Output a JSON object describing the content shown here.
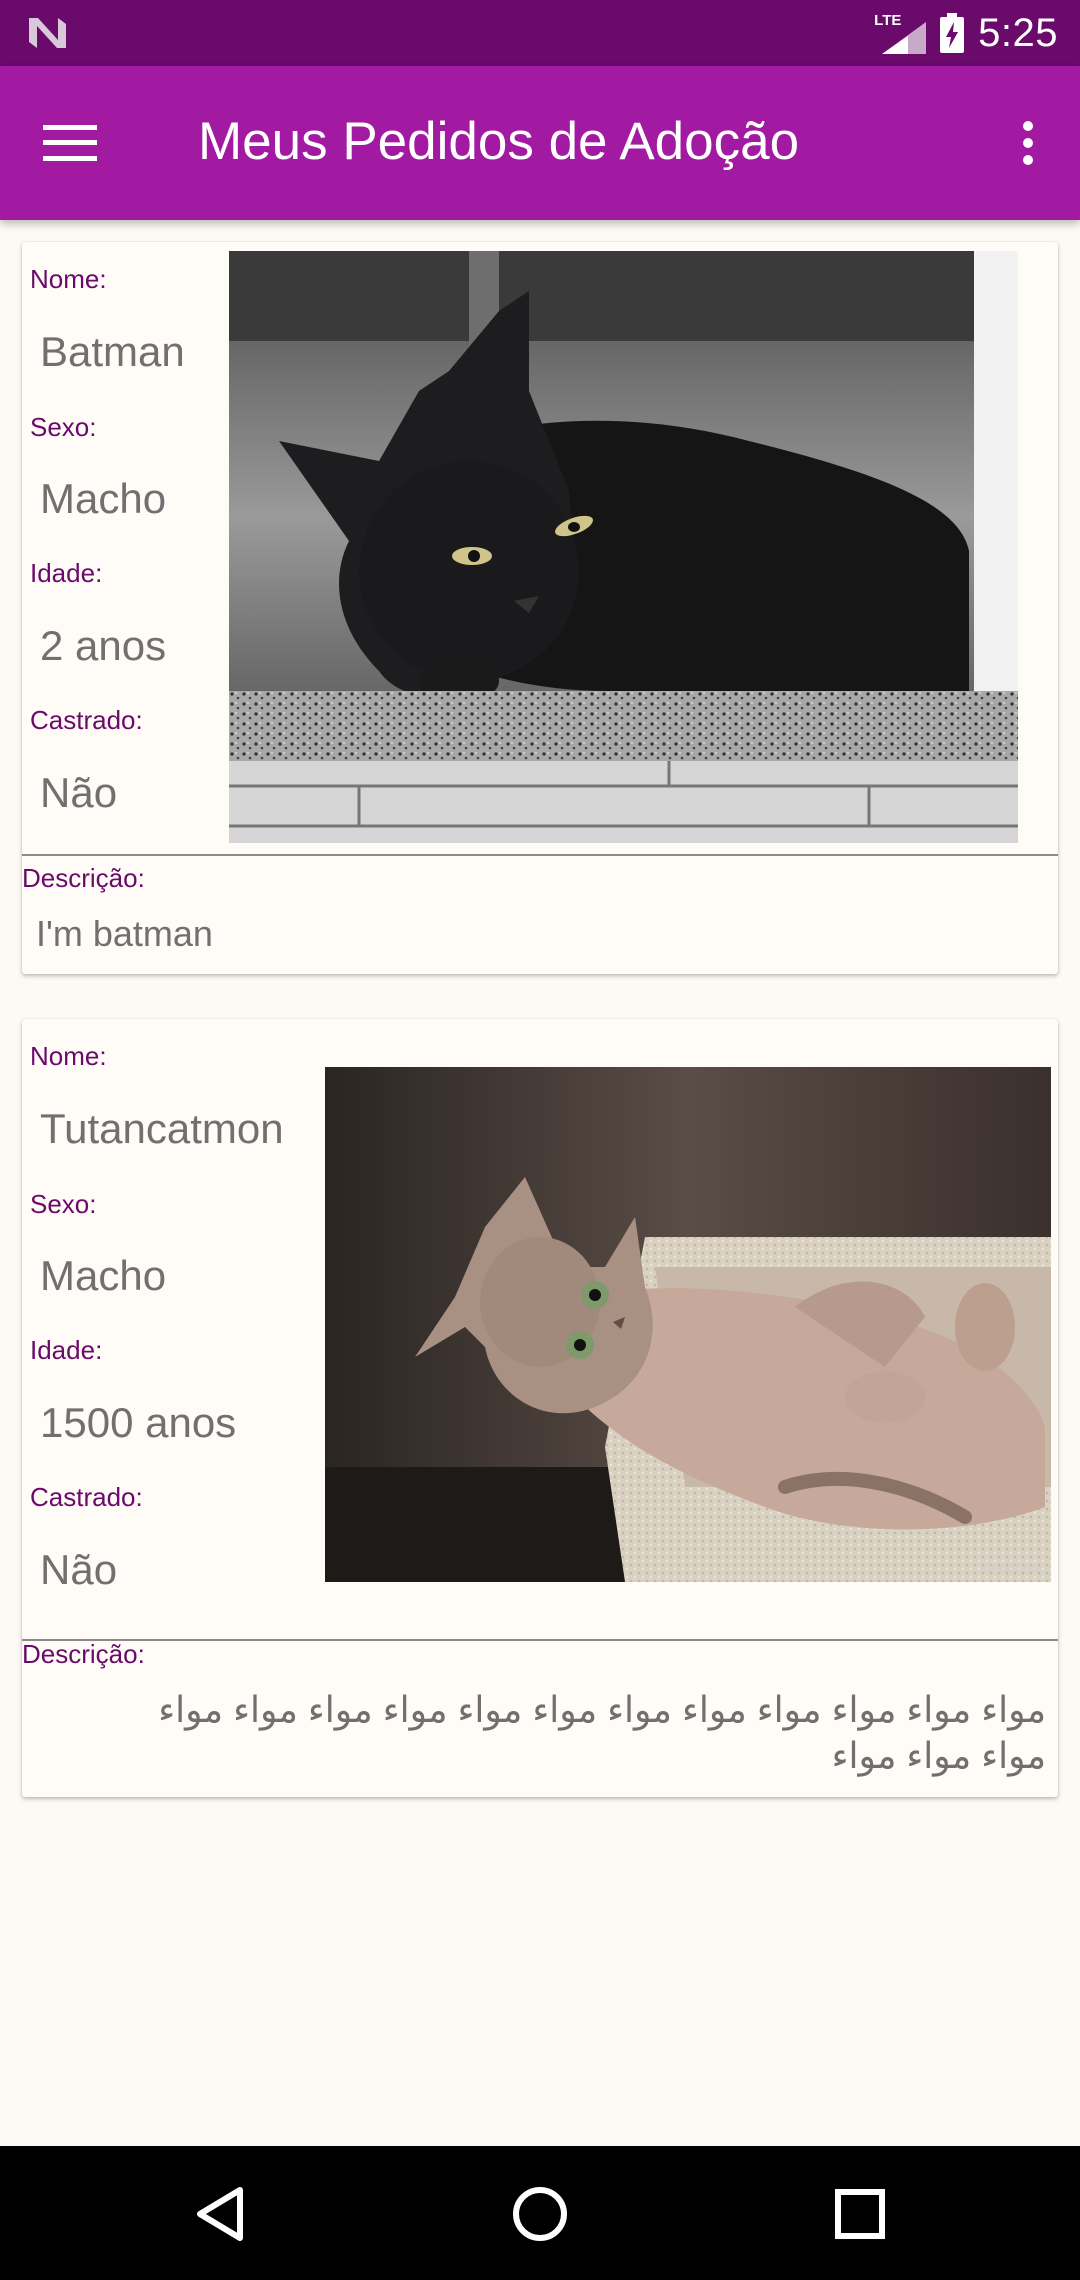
{
  "status_bar": {
    "network_label": "LTE",
    "time": "5:25"
  },
  "app_bar": {
    "title": "Meus Pedidos de Adoção"
  },
  "pets": [
    {
      "name_label": "Nome:",
      "name": "Batman",
      "sex_label": "Sexo:",
      "sex": "Macho",
      "age_label": "Idade:",
      "age": "2 anos",
      "neutered_label": "Castrado:",
      "neutered": "Não",
      "description_label": "Descrição:",
      "description": "I'm batman"
    },
    {
      "name_label": "Nome:",
      "name": "Tutancatmon",
      "sex_label": "Sexo:",
      "sex": "Macho",
      "age_label": "Idade:",
      "age": "1500 anos",
      "neutered_label": "Castrado:",
      "neutered": "Não",
      "description_label": "Descrição:",
      "description": "مواء مواء مواء مواء مواء مواء مواء مواء مواء مواء مواء مواء مواء مواء مواء"
    }
  ],
  "colors": {
    "status_bar": "#6a0a6a",
    "app_bar": "#a11aa1",
    "label": "#6a0a6a",
    "value": "#707070",
    "background": "#fdfaf6"
  }
}
